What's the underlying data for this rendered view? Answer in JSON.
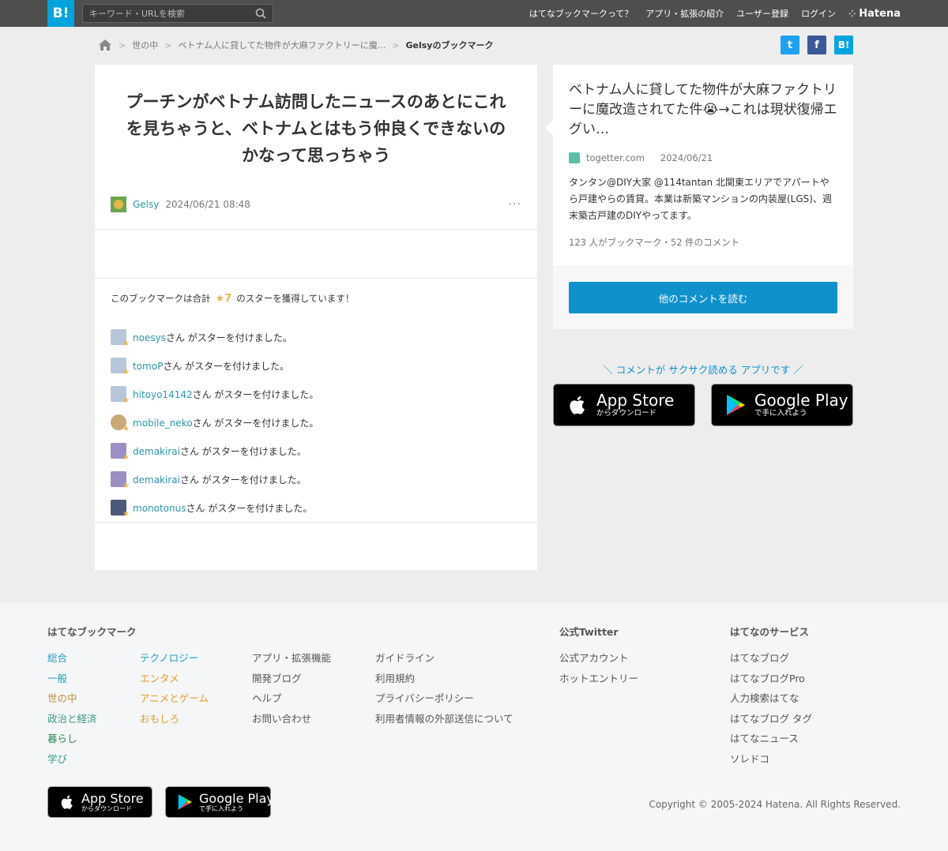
{
  "header": {
    "logo": "B!",
    "search_placeholder": "キーワード・URLを検索",
    "nav": [
      "はてなブックマークって？",
      "アプリ・拡張の紹介",
      "ユーザー登録",
      "ログイン"
    ],
    "hatena_brand": "Hatena"
  },
  "breadcrumb": {
    "items": [
      "世の中",
      "ベトナム人に貸してた物件が大麻ファクトリーに魔..."
    ],
    "current": "Gelsyのブックマーク"
  },
  "share": {
    "twitter_label": "t",
    "facebook_label": "f",
    "hatena_label": "B!"
  },
  "bookmark": {
    "comment": "プーチンがベトナム訪問したニュースのあとにこれを見ちゃうと、ベトナムとはもう仲良くできないのかなって思っちゃう",
    "user": "Gelsy",
    "date": "2024/06/21 08:48",
    "more": "···"
  },
  "stars": {
    "summary_prefix": "このブックマークは合計",
    "count": "★7",
    "summary_suffix": "のスターを獲得しています！",
    "suffix_text": "さん がスターを付けました。",
    "items": [
      {
        "user": "noesys",
        "color": "#b7c7d9"
      },
      {
        "user": "tomoP",
        "color": "#b7c7d9"
      },
      {
        "user": "hitoyo14142",
        "color": "#b7c7d9"
      },
      {
        "user": "mobile_neko",
        "color": "#c9a978"
      },
      {
        "user": "demakirai",
        "color": "#9b8fc4"
      },
      {
        "user": "demakirai",
        "color": "#9b8fc4"
      },
      {
        "user": "monotonus",
        "color": "#4a5a78"
      }
    ]
  },
  "entry": {
    "title": "ベトナム人に貸してた物件が大麻ファクトリーに魔改造されてた件😭→これは現状復帰エグい…",
    "site": "togetter.com",
    "date": "2024/06/21",
    "description": "タンタン@DIY大家 @114tantan 北関東エリアでアパートやら戸建やらの賃貸。本業は新築マンションの内装屋(LGS)、週末築古戸建のDIYやってます。",
    "stats": "123 人がブックマーク・52 件のコメント",
    "read_button": "他のコメントを読む"
  },
  "app_promo": {
    "text": "＼ コメントが サクサク読める アプリです ／",
    "app_store_title": "App Store",
    "app_store_sub": "からダウンロード",
    "google_play_title": "Google Play",
    "google_play_sub": "で手に入れよう"
  },
  "footer": {
    "col1_heading": "はてなブックマーク",
    "categories_a": [
      "総合",
      "一般",
      "世の中",
      "政治と経済",
      "暮らし",
      "学び"
    ],
    "categories_b": [
      "テクノロジー",
      "エンタメ",
      "アニメとゲーム",
      "おもしろ"
    ],
    "links_c": [
      "アプリ・拡張機能",
      "開発ブログ",
      "ヘルプ",
      "お問い合わせ"
    ],
    "links_d": [
      "ガイドライン",
      "利用規約",
      "プライバシーポリシー",
      "利用者情報の外部送信について"
    ],
    "twitter_heading": "公式Twitter",
    "twitter_links": [
      "公式アカウント",
      "ホットエントリー"
    ],
    "services_heading": "はてなのサービス",
    "services": [
      "はてなブログ",
      "はてなブログPro",
      "人力検索はてな",
      "はてなブログ タグ",
      "はてなニュース",
      "ソレドコ"
    ],
    "copyright": "Copyright © 2005-2024 Hatena. All Rights Reserved."
  },
  "colors": {
    "accent": "#00a4de",
    "link": "#2c97a8",
    "star": "#e8b64c",
    "button": "#0f92cb"
  }
}
